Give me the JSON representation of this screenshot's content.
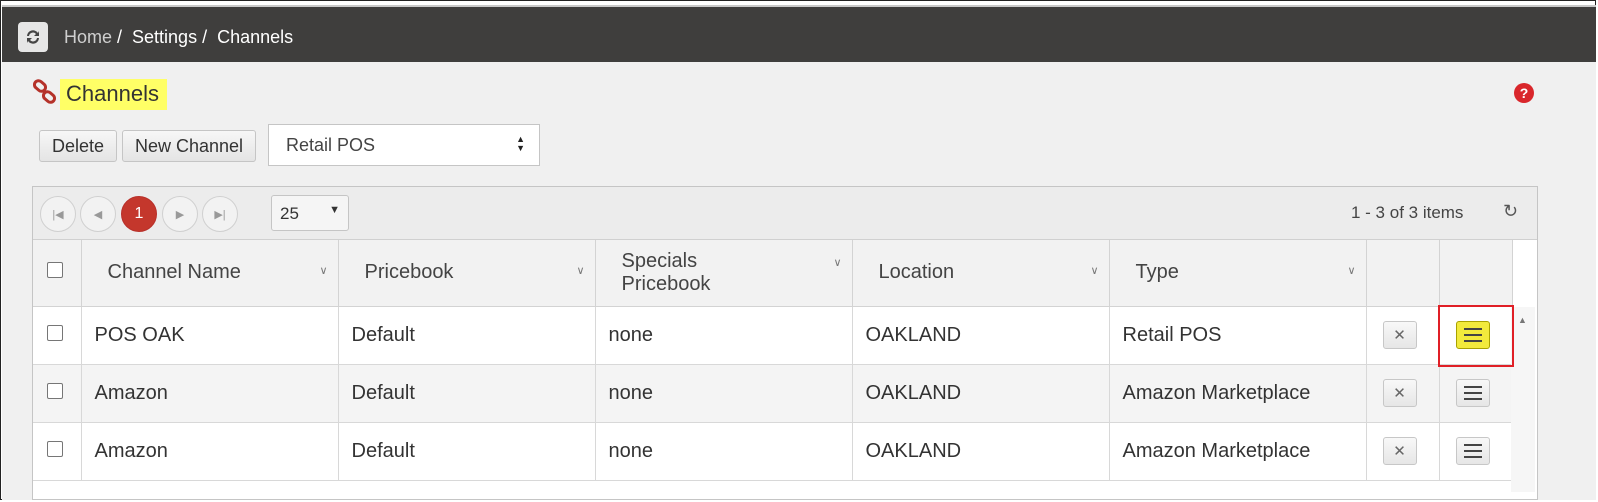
{
  "breadcrumb": {
    "home": "Home",
    "settings": "Settings",
    "current": "Channels",
    "sep": " /  "
  },
  "page": {
    "title": "Channels",
    "help_icon": "question-circle-icon",
    "accent": "#ffff66"
  },
  "toolbar": {
    "delete_label": "Delete",
    "new_label": "New Channel",
    "channel_type_select": "Retail POS"
  },
  "pager": {
    "current_page": "1",
    "page_size": "25",
    "info": "1 - 3 of 3 items"
  },
  "columns": [
    "Channel Name",
    "Pricebook",
    "Specials Pricebook",
    "Location",
    "Type"
  ],
  "rows": [
    {
      "name": "POS OAK",
      "pricebook": "Default",
      "specials": "none",
      "location": "OAKLAND",
      "type": "Retail POS"
    },
    {
      "name": "Amazon",
      "pricebook": "Default",
      "specials": "none",
      "location": "OAKLAND",
      "type": "Amazon Marketplace"
    },
    {
      "name": "Amazon",
      "pricebook": "Default",
      "specials": "none",
      "location": "OAKLAND",
      "type": "Amazon Marketplace"
    }
  ]
}
